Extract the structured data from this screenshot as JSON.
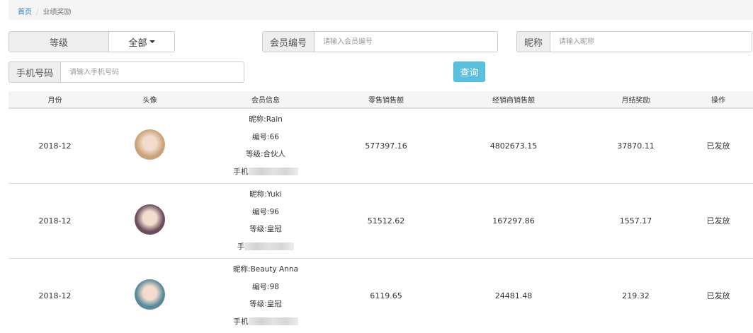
{
  "breadcrumb": {
    "home": "首页",
    "current": "业绩奖励"
  },
  "filters": {
    "level_label": "等级",
    "level_value": "全部",
    "member_no_label": "会员编号",
    "member_no_placeholder": "请输入会员编号",
    "nickname_label": "昵称",
    "nickname_placeholder": "请输入昵称",
    "phone_label": "手机号码",
    "phone_placeholder": "请输入手机号码",
    "search_button": "查询"
  },
  "table": {
    "headers": [
      "月份",
      "头像",
      "会员信息",
      "零售销售额",
      "经销商销售额",
      "月结奖励",
      "操作"
    ],
    "rows": [
      {
        "month": "2018-12",
        "nickname": "昵称:Rain",
        "number": "编号:66",
        "level": "等级:合伙人",
        "phone": "手机",
        "retail": "577397.16",
        "dealer": "4802673.15",
        "reward": "37870.11",
        "action": "已发放",
        "avatar_color": "#c9a27a"
      },
      {
        "month": "2018-12",
        "nickname": "昵称:Yuki",
        "number": "编号:96",
        "level": "等级:皇冠",
        "phone": "手",
        "retail": "51512.62",
        "dealer": "167297.86",
        "reward": "1557.17",
        "action": "已发放",
        "avatar_color": "#6b4e5e"
      },
      {
        "month": "2018-12",
        "nickname": "昵称:Beauty Anna",
        "number": "编号:98",
        "level": "等级:皇冠",
        "phone": "手机",
        "retail": "6119.65",
        "dealer": "24481.48",
        "reward": "219.32",
        "action": "已发放",
        "avatar_color": "#5a8a9a"
      }
    ]
  }
}
